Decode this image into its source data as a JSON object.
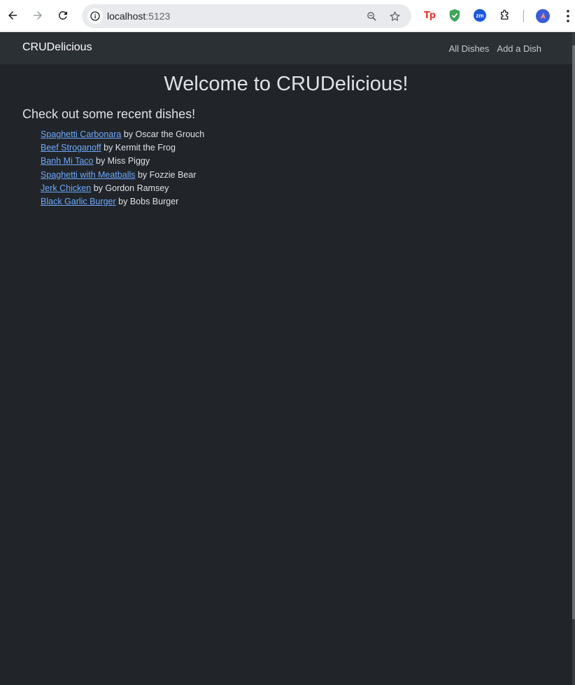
{
  "browser": {
    "url_host": "localhost",
    "url_port": ":5123"
  },
  "navbar": {
    "brand": "CRUDelicious",
    "links": [
      {
        "label": "All Dishes"
      },
      {
        "label": "Add a Dish"
      }
    ]
  },
  "main": {
    "title": "Welcome to CRUDelicious!",
    "subtitle": "Check out some recent dishes!",
    "dishes": [
      {
        "name": "Spaghetti Carbonara",
        "chef": "by Oscar the Grouch"
      },
      {
        "name": "Beef Stroganoff",
        "chef": "by Kermit the Frog"
      },
      {
        "name": "Banh Mi Taco",
        "chef": "by Miss Piggy"
      },
      {
        "name": "Spaghetti with Meatballs",
        "chef": "by Fozzie Bear"
      },
      {
        "name": "Jerk Chicken",
        "chef": "by Gordon Ramsey"
      },
      {
        "name": "Black Garlic Burger",
        "chef": "by Bobs Burger"
      }
    ]
  },
  "colors": {
    "background": "#212529",
    "navbar": "#2b3035",
    "link": "#6ea8fe",
    "text": "#dee2e6"
  },
  "icons": [
    "back-arrow-icon",
    "forward-arrow-icon",
    "reload-icon",
    "info-icon",
    "zoom-icon",
    "star-icon",
    "tp-extension-icon",
    "shield-extension-icon",
    "zm-extension-icon",
    "puzzle-icon",
    "profile-icon",
    "kebab-menu-icon"
  ]
}
